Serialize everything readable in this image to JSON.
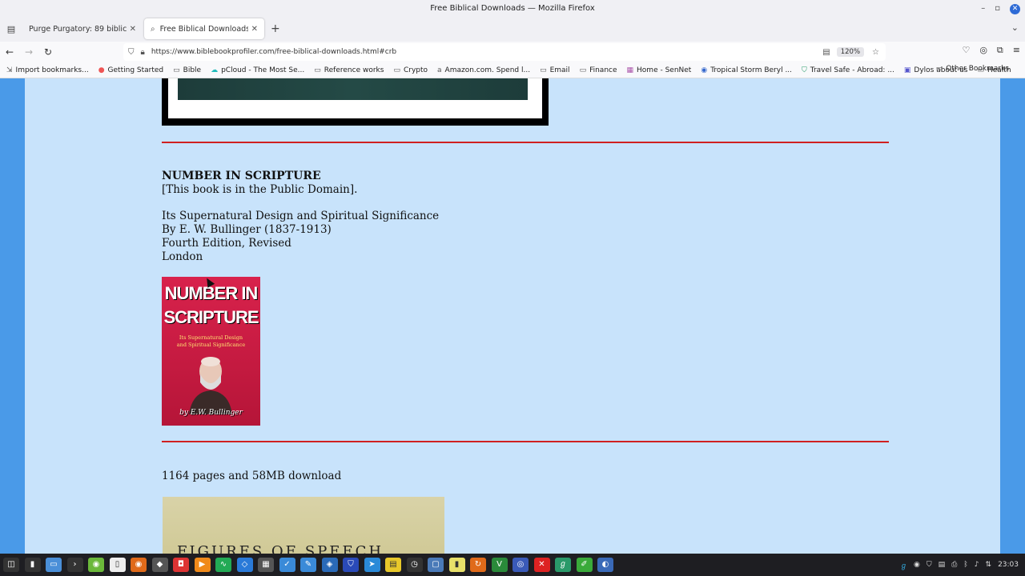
{
  "window": {
    "title": "Free Biblical Downloads — Mozilla Firefox"
  },
  "tabs": [
    {
      "label": "Purge Purgatory: 89 biblical re",
      "active": false
    },
    {
      "label": "Free Biblical Downloads",
      "active": true
    }
  ],
  "url": "https://www.biblebookprofiler.com/free-biblical-downloads.html#crb",
  "zoom": "120%",
  "bookmarks": [
    "Import bookmarks...",
    "Getting Started",
    "Bible",
    "pCloud - The Most Se...",
    "Reference works",
    "Crypto",
    "Amazon.com. Spend l...",
    "Email",
    "Finance",
    "Home - SenNet",
    "Tropical Storm Beryl ...",
    "Travel Safe - Abroad: ...",
    "Dylos about us",
    "Health"
  ],
  "other_bookmarks": "Other Bookmarks",
  "content": {
    "book_title": "NUMBER IN SCRIPTURE",
    "public_domain": "[This book is in the Public Domain].",
    "subtitle": "Its Supernatural Design and Spiritual Significance",
    "author": "By E. W. Bullinger (1837-1913)",
    "edition": "Fourth Edition, Revised",
    "place": "London",
    "cover": {
      "title_1": "NUMBER IN",
      "title_2": "SCRIPTURE",
      "sub_1": "Its Supernatural Design",
      "sub_2": "and Spiritual Significance",
      "by": "by E.W. Bullinger"
    },
    "next_book_info": "1164 pages and 58MB download",
    "next_cover_text": "FIGURES OF SPEECH"
  },
  "taskbar": {
    "clock": "23:03"
  },
  "colors": {
    "page_bg": "#c8e3fb",
    "side_bg": "#4a9ae8",
    "rule": "#d02020",
    "cover": "#d8224c"
  }
}
